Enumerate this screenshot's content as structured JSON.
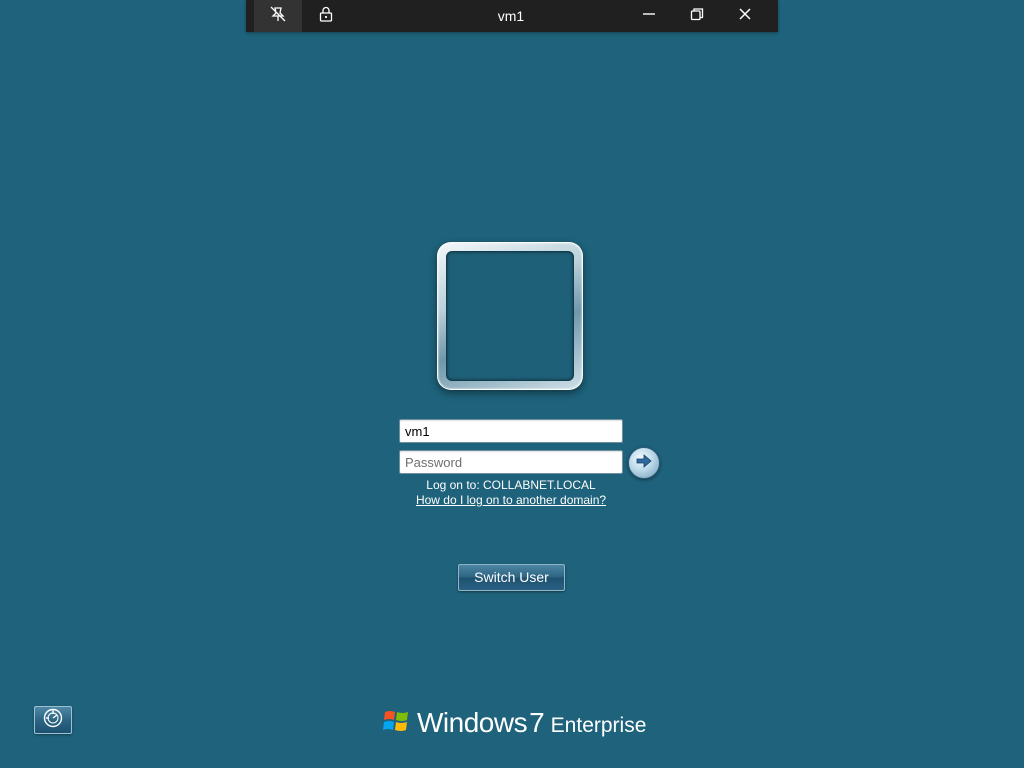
{
  "connection_bar": {
    "title": "vm1",
    "pin_icon": "unpin-icon",
    "lock_icon": "lock-icon",
    "minimize_icon": "minimize-icon",
    "restore_icon": "restore-icon",
    "close_icon": "close-icon"
  },
  "logon": {
    "username_value": "vm1",
    "password_placeholder": "Password",
    "submit_icon": "arrow-right-icon",
    "log_on_to": "Log on to: COLLABNET.LOCAL",
    "another_domain_link": "How do I log on to another domain?",
    "switch_user_label": "Switch User"
  },
  "footer": {
    "ease_of_access_icon": "ease-of-access-icon",
    "brand_windows": "Windows",
    "brand_version": "7",
    "brand_edition": "Enterprise"
  },
  "colors": {
    "background": "#1e627b",
    "connection_bar": "#202020"
  }
}
